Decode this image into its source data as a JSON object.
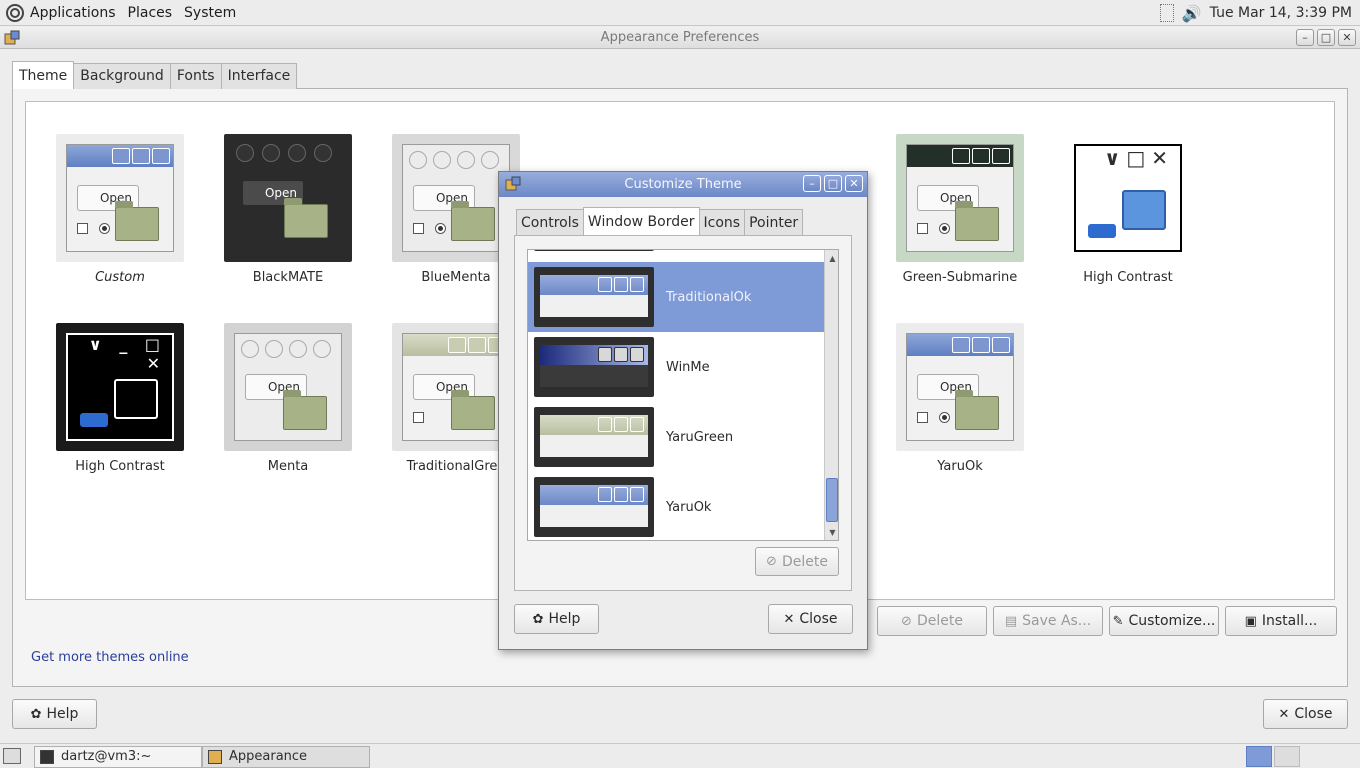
{
  "top_panel": {
    "menus": [
      "Applications",
      "Places",
      "System"
    ],
    "clock": "Tue Mar 14,  3:39 PM"
  },
  "main_window": {
    "title": "Appearance Preferences",
    "tabs": [
      "Theme",
      "Background",
      "Fonts",
      "Interface"
    ],
    "active_tab": "Theme",
    "themes": [
      {
        "label": "Custom"
      },
      {
        "label": "BlackMATE"
      },
      {
        "label": "BlueMenta"
      },
      {
        "label": "Green-Submarine"
      },
      {
        "label": "High Contrast"
      },
      {
        "label": "High Contrast"
      },
      {
        "label": "Menta"
      },
      {
        "label": "TraditionalGree"
      },
      {
        "label": "YaruOk"
      }
    ],
    "mini_open_label": "Open",
    "get_more_link": "Get more themes online",
    "buttons": {
      "delete": "Delete",
      "save_as": "Save As...",
      "customize": "Customize...",
      "install": "Install...",
      "help": "Help",
      "close": "Close"
    }
  },
  "dialog": {
    "title": "Customize Theme",
    "tabs": [
      "Controls",
      "Window Border",
      "Icons",
      "Pointer"
    ],
    "active_tab": "Window Border",
    "borders": [
      {
        "label": "TraditionalOk",
        "selected": true
      },
      {
        "label": "WinMe",
        "selected": false
      },
      {
        "label": "YaruGreen",
        "selected": false
      },
      {
        "label": "YaruOk",
        "selected": false
      }
    ],
    "delete_label": "Delete",
    "help_label": "Help",
    "close_label": "Close"
  },
  "taskbar": {
    "tasks": [
      "dartz@vm3:~",
      "Appearance Prefere..."
    ]
  },
  "colors": {
    "selection": "#7f9bd7",
    "titlebar": "#6c88c7",
    "link": "#2a3e9c"
  }
}
